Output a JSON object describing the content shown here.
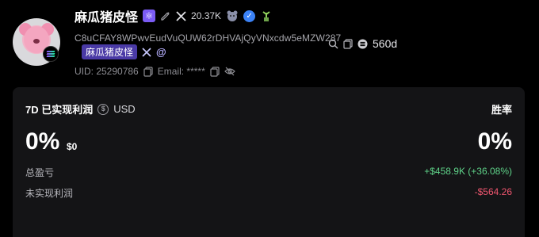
{
  "profile": {
    "name": "麻瓜猪皮怪",
    "followers": "20.37K",
    "address": "C8uCFAY8WPwvEudVuQUW62rDHVAjQyVNxcdw5eMZW287",
    "age": "560d",
    "tag": "麻瓜猪皮怪",
    "uid": "UID: 25290786",
    "email": "Email: *****"
  },
  "stats": {
    "title": "7D 已实现利润",
    "currency": "USD",
    "winrate_label": "胜率",
    "pnl_percent": "0%",
    "pnl_usd": "$0",
    "winrate_value": "0%",
    "total_label": "总盈亏",
    "total_value": "+$458.9K (+36.08%)",
    "unrealized_label": "未实现利润",
    "unrealized_value": "-$564.26"
  },
  "colors": {
    "positive": "#5fd389",
    "negative": "#f0566f",
    "accent": "#4a3aa6"
  }
}
